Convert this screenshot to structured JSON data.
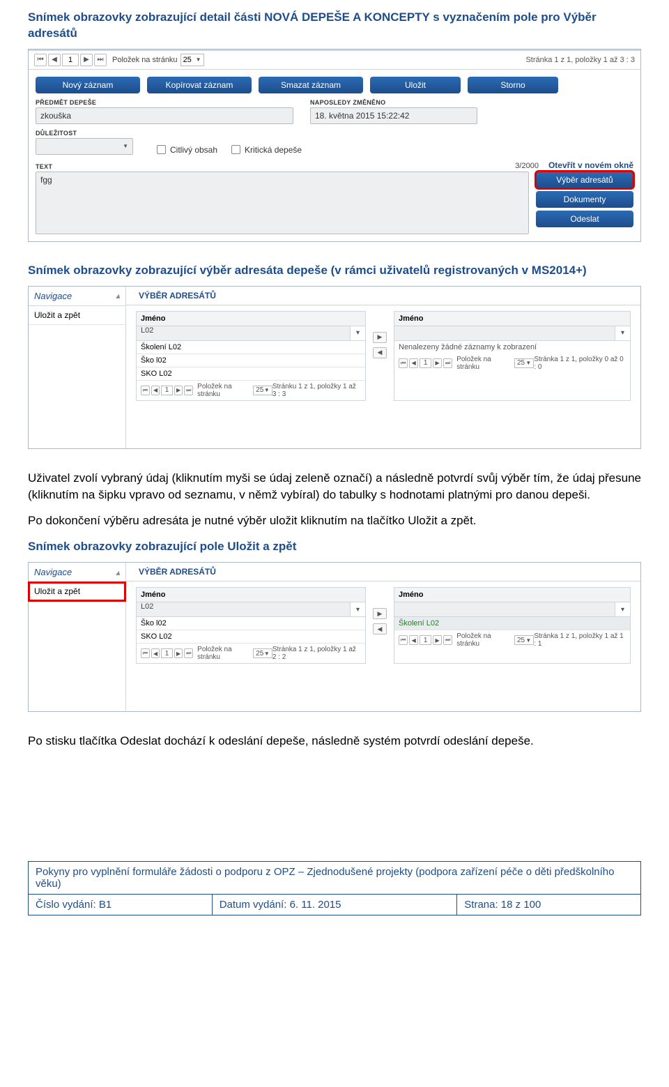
{
  "heading1": "Snímek obrazovky zobrazující detail části NOVÁ DEPEŠE A KONCEPTY s vyznačením pole pro Výběr adresátů",
  "fig1": {
    "pager_items_label": "Položek na stránku",
    "pager_items_value": "25",
    "pager_status": "Stránka 1 z 1, položky 1 až 3 : 3",
    "toolbar": {
      "new": "Nový záznam",
      "copy": "Kopírovat záznam",
      "delete": "Smazat záznam",
      "save": "Uložit",
      "cancel": "Storno"
    },
    "labels": {
      "subject": "PŘEDMĚT DEPEŠE",
      "lastmod": "NAPOSLEDY ZMĚNĚNO",
      "importance": "DŮLEŽITOST",
      "text": "TEXT"
    },
    "subject_value": "zkouška",
    "lastmod_value": "18. května 2015 15:22:42",
    "cb_sensitive": "Citlivý obsah",
    "cb_critical": "Kritická depeše",
    "counter": "3/2000",
    "open_new": "Otevřít v novém okně",
    "text_value": "fgg",
    "side": {
      "recipients": "Výběr adresátů",
      "docs": "Dokumenty",
      "send": "Odeslat"
    }
  },
  "heading2": "Snímek obrazovky zobrazující výběr adresáta depeše (v rámci uživatelů registrovaných v MS2014+)",
  "fig2": {
    "nav_title": "Navigace",
    "nav_item": "Uložit a zpět",
    "section": "VÝBĚR ADRESÁTŮ",
    "col_name": "Jméno",
    "left_filter": "L02",
    "left_items": [
      "Školení L02",
      "Ško l02",
      "SKO L02"
    ],
    "left_pager_label": "Položek na stránku",
    "left_pager_val": "25",
    "left_pager_status": "Stránku 1 z 1, položky 1 až 3 : 3",
    "right_empty": "Nenalezeny žádné záznamy k zobrazení",
    "right_pager_label": "Položek na stránku",
    "right_pager_val": "25",
    "right_pager_status": "Stránka 1 z 1, položky 0 až 0 : 0"
  },
  "para1": "Uživatel zvolí vybraný údaj (kliknutím myši se údaj zeleně označí) a následně potvrdí svůj výběr tím, že údaj přesune (kliknutím na šipku vpravo od seznamu, v němž vybíral) do tabulky s hodnotami platnými pro danou depeši.",
  "para2": "Po dokončení výběru adresáta je nutné výběr uložit kliknutím na tlačítko Uložit a zpět.",
  "heading3": "Snímek obrazovky zobrazující pole Uložit a zpět",
  "fig3": {
    "nav_title": "Navigace",
    "nav_item": "Uložit a zpět",
    "section": "VÝBĚR ADRESÁTŮ",
    "col_name": "Jméno",
    "left_filter": "L02",
    "left_items": [
      "Ško l02",
      "SKO L02"
    ],
    "left_pager_label": "Položek na stránku",
    "left_pager_val": "25",
    "left_pager_status": "Stránka 1 z 1, položky 1 až 2 : 2",
    "right_items": [
      "Školení L02"
    ],
    "right_pager_label": "Položek na stránku",
    "right_pager_val": "25",
    "right_pager_status": "Stránka 1 z 1, položky 1 až 1 : 1"
  },
  "para3": "Po stisku tlačítka Odeslat dochází k odeslání depeše, následně systém potvrdí odeslání depeše.",
  "footer": {
    "top": "Pokyny pro vyplnění formuláře žádosti o podporu z OPZ – Zjednodušené projekty (podpora zařízení péče o děti předškolního věku)",
    "issue_label": "Číslo vydání: B1",
    "date_label": "Datum vydání: 6. 11. 2015",
    "page_label": "Strana: 18 z 100"
  }
}
